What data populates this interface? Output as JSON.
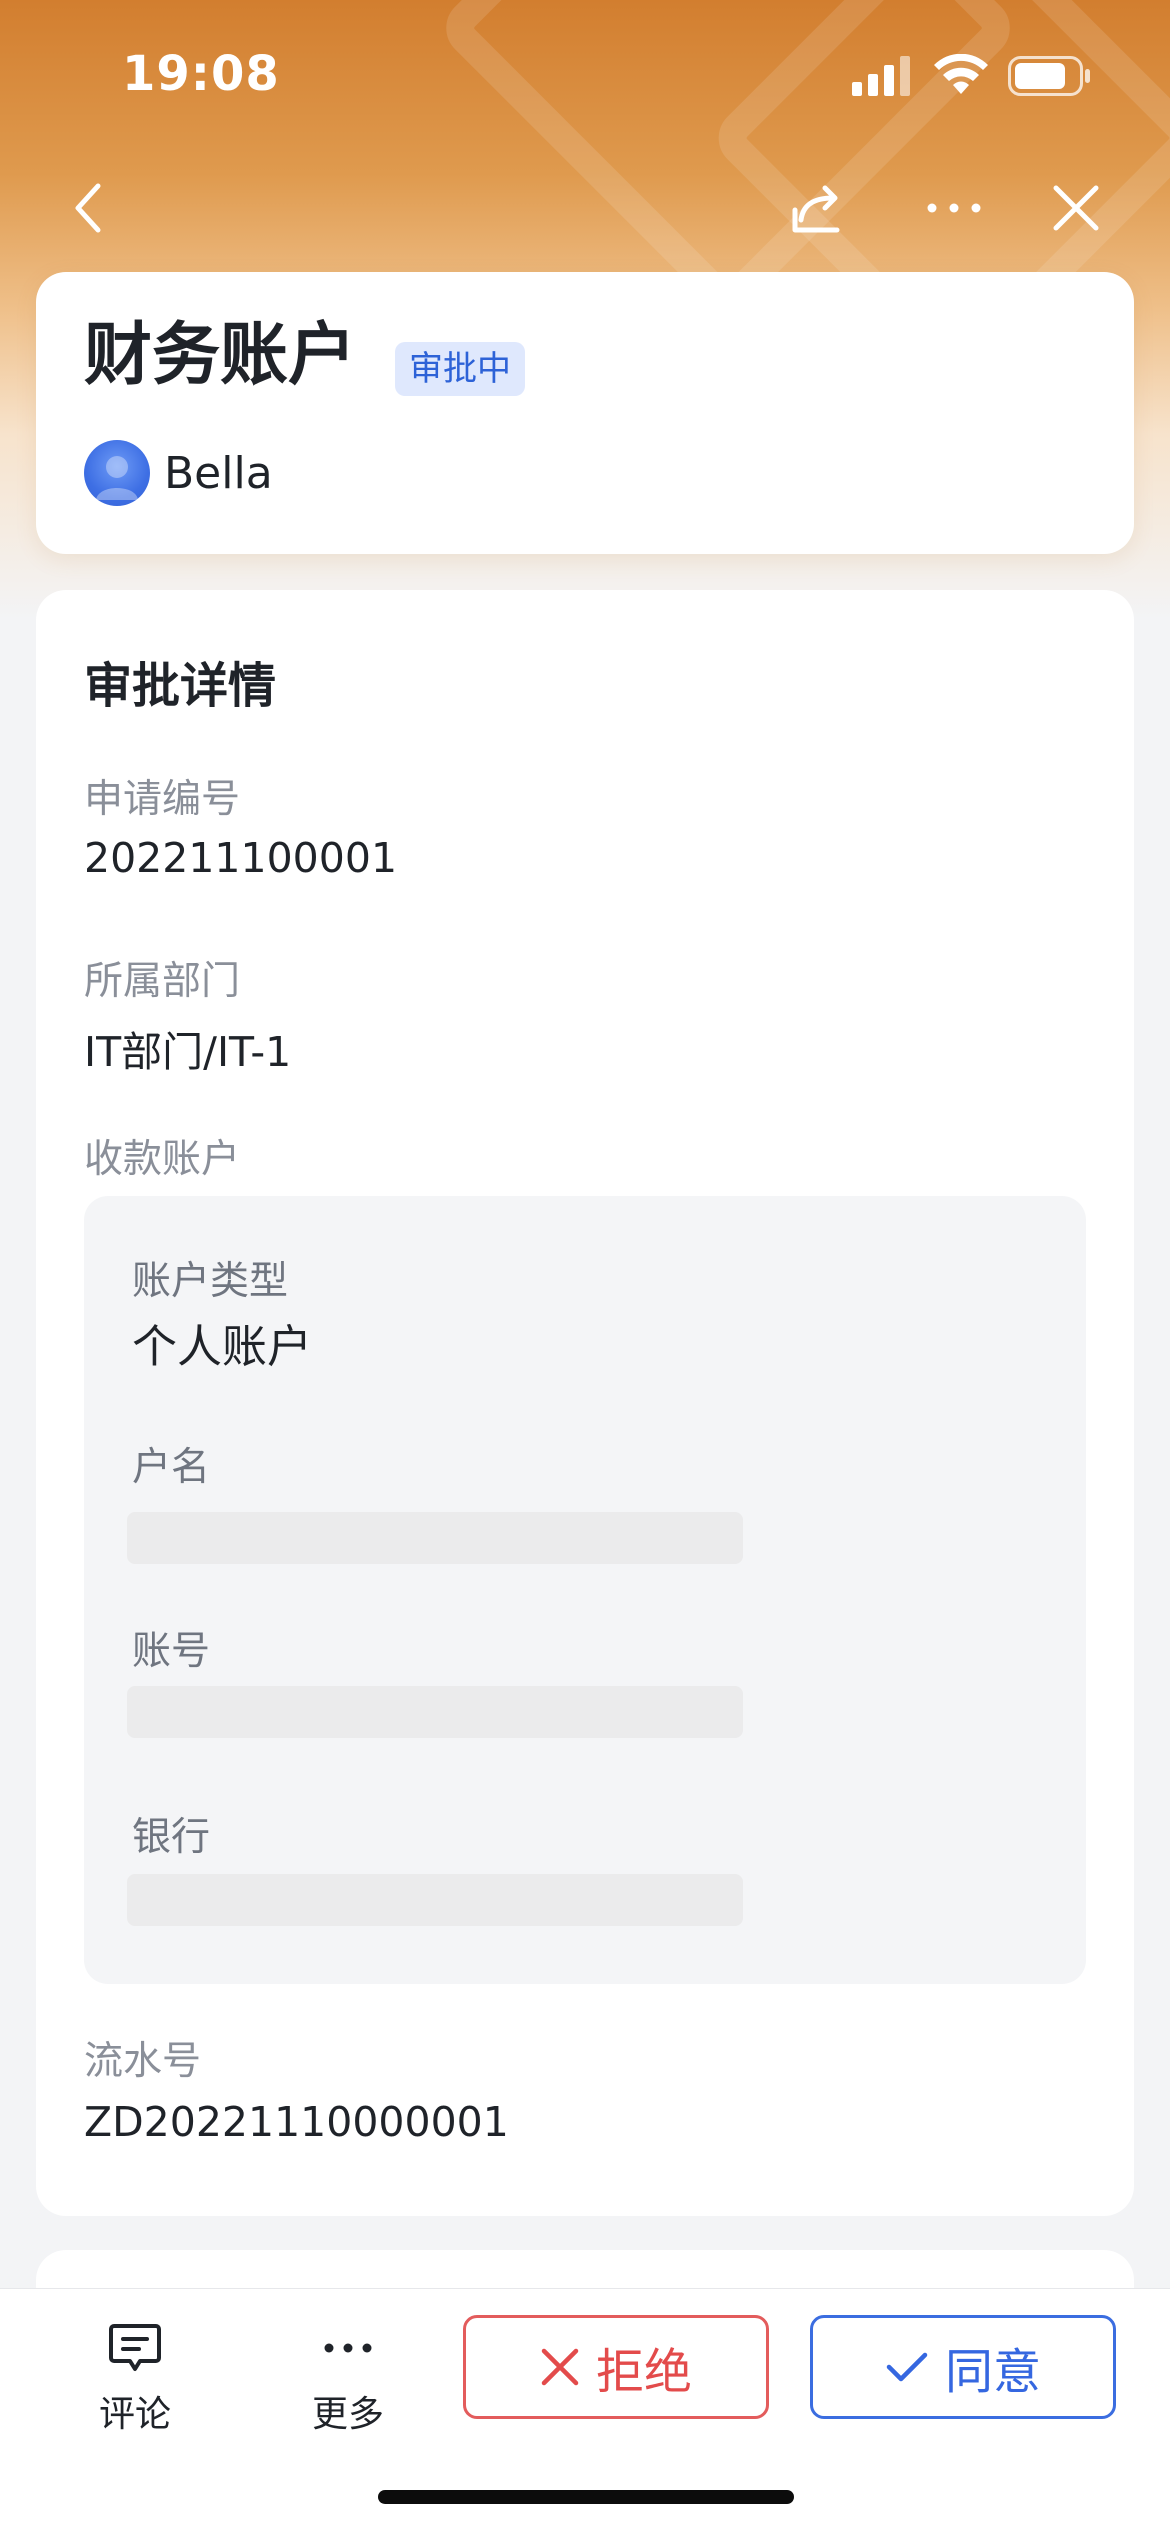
{
  "status_bar": {
    "time": "19:08"
  },
  "nav": {
    "back_icon": "chevron-left-icon",
    "share_icon": "share-icon",
    "more_icon": "more-horizontal-icon",
    "close_icon": "close-icon"
  },
  "header": {
    "title": "财务账户",
    "status_badge": "审批中",
    "applicant_name": "Bella"
  },
  "details": {
    "section_title": "审批详情",
    "fields": {
      "application_no_label": "申请编号",
      "application_no_value": "202211100001",
      "department_label": "所属部门",
      "department_value": "IT部门/IT-1",
      "payee_account_label": "收款账户",
      "serial_no_label": "流水号",
      "serial_no_value": "ZD20221110000001"
    },
    "payee_account": {
      "account_type_label": "账户类型",
      "account_type_value": "个人账户",
      "account_name_label": "户名",
      "account_number_label": "账号",
      "bank_label": "银行"
    }
  },
  "bottom_bar": {
    "comment_label": "评论",
    "more_label": "更多",
    "reject_label": "拒绝",
    "approve_label": "同意"
  },
  "colors": {
    "header_orange": "#d27e2f",
    "badge_bg": "#dfe8fd",
    "badge_text": "#2d62d7",
    "reject_red": "#e34b4b",
    "approve_blue": "#3567e0"
  }
}
